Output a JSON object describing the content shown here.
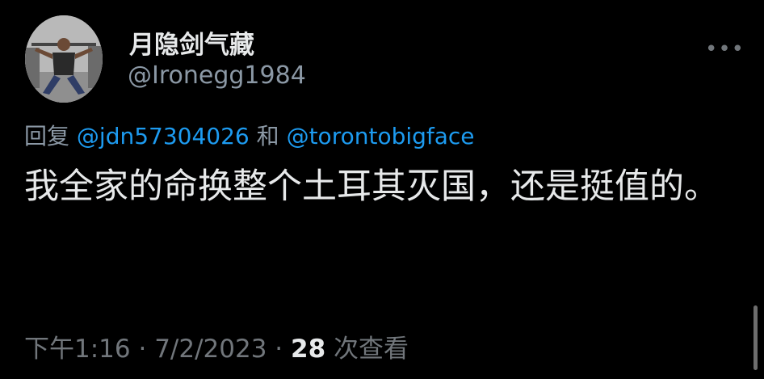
{
  "author": {
    "display_name": "月隐剑气藏",
    "handle": "@Ironegg1984"
  },
  "reply": {
    "prefix": "回复",
    "mention_1": "@jdn57304026",
    "conjunction": "和",
    "mention_2": "@torontobigface"
  },
  "tweet": {
    "text": "我全家的命换整个土耳其灭国，还是挺值的。"
  },
  "meta": {
    "time": "下午1:16",
    "separator_1": "·",
    "date": "7/2/2023",
    "separator_2": "·",
    "views_count": "28",
    "views_label": "次查看"
  },
  "icons": {
    "more": "more-horizontal-icon"
  },
  "colors": {
    "background": "#000000",
    "text": "#e7e9ea",
    "secondary": "#71767b",
    "link": "#1d9bf0"
  }
}
